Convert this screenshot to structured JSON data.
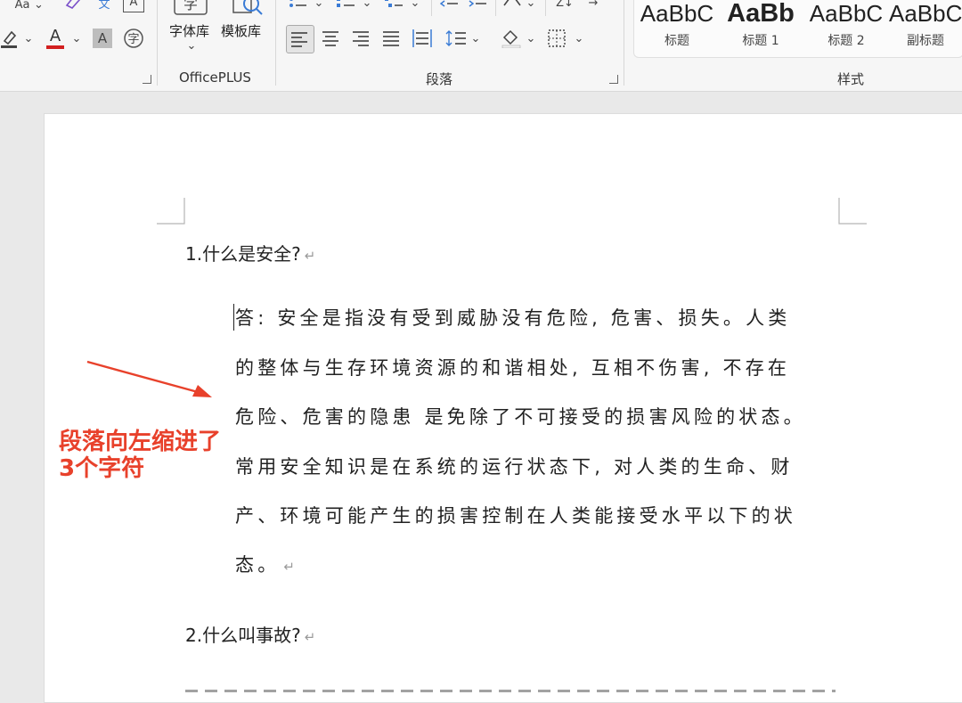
{
  "ribbon": {
    "tools_top_row": [
      "Aa",
      "文",
      "A"
    ],
    "font_library": "字体库",
    "template_library": "模板库",
    "dropdown_glyph": "⌄",
    "officeplus_group": "OfficePLUS",
    "paragraph_group": "段落",
    "styles_group": "样式",
    "styles": [
      {
        "preview": "AaBbC",
        "label": "标题"
      },
      {
        "preview": "AaBb",
        "label": "标题 1"
      },
      {
        "preview": "AaBbC",
        "label": "标题 2"
      },
      {
        "preview": "AaBbC",
        "label": "副标题"
      }
    ]
  },
  "document": {
    "q1": "1.什么是安全?",
    "a1_lines": [
      "答: 安全是指没有受到威胁没有危险, 危害、损失。人类",
      "的整体与生存环境资源的和谐相处, 互相不伤害, 不存在",
      "危险、危害的隐患 是免除了不可接受的损害风险的状态。",
      "常用安全知识是在系统的运行状态下, 对人类的生命、财",
      "产、环境可能产生的损害控制在人类能接受水平以下的状",
      "态。"
    ],
    "q2": "2.什么叫事故?",
    "paragraph_mark": "↵",
    "accent_color": "#e8412b"
  },
  "annotation": {
    "line1": "段落向左缩进了",
    "line2": "3个字符"
  }
}
